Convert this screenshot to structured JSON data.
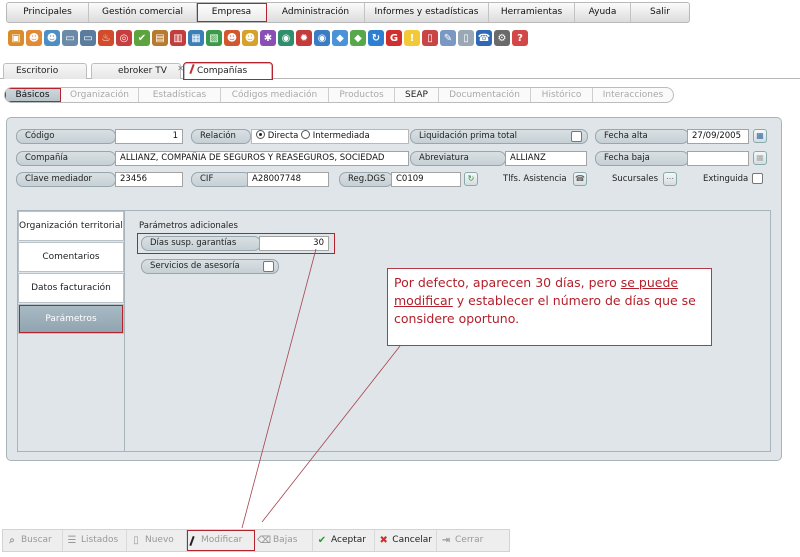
{
  "menu": {
    "items": [
      "Principales",
      "Gestión comercial",
      "Empresa",
      "Administración",
      "Informes y estadísticas",
      "Herramientas",
      "Ayuda",
      "Salir"
    ],
    "active_index": 2
  },
  "window_tabs": {
    "escritorio": "Escritorio",
    "ebroker": "ebroker TV",
    "companias": "Compañías",
    "close_glyph": "✕"
  },
  "section_tabs": [
    "Básicos",
    "Organización",
    "Estadísticas",
    "Códigos mediación",
    "Productos",
    "SEAP",
    "Documentación",
    "Histórico",
    "Interacciones"
  ],
  "form": {
    "codigo_label": "Código",
    "codigo_value": "1",
    "relacion_label": "Relación",
    "relacion_directa": "Directa",
    "relacion_intermediada": "Intermediada",
    "liquidacion_label": "Liquidación prima total",
    "fecha_alta_label": "Fecha alta",
    "fecha_alta_value": "27/09/2005",
    "compania_label": "Compañía",
    "compania_value": "ALLIANZ, COMPAÑIA DE SEGUROS Y REASEGUROS, SOCIEDAD",
    "abreviatura_label": "Abreviatura",
    "abreviatura_value": "ALLIANZ",
    "fecha_baja_label": "Fecha baja",
    "fecha_baja_value": "",
    "clave_label": "Clave mediador",
    "clave_value": "23456",
    "cif_label": "CIF",
    "cif_value": "A28007748",
    "regdgs_label": "Reg.DGS",
    "regdgs_value": "C0109",
    "tlfs_label": "Tlfs. Asistencia",
    "sucursales_label": "Sucursales",
    "extinguida_label": "Extinguida"
  },
  "side_tabs": [
    "Organización territorial",
    "Comentarios",
    "Datos facturación",
    "Parámetros"
  ],
  "params": {
    "title": "Parámetros adicionales",
    "dias_label": "Días susp. garantías",
    "dias_value": "30",
    "servicios_label": "Servicios de asesoría"
  },
  "callout": {
    "part1": "Por defecto, aparecen 30 días, pero ",
    "underlined": "se puede modificar",
    "part2": " y establecer el número de días que se considere oportuno."
  },
  "bottom_bar": [
    "Buscar",
    "Listados",
    "Nuevo",
    "Modificar",
    "Bajas",
    "Aceptar",
    "Cancelar",
    "Cerrar"
  ]
}
